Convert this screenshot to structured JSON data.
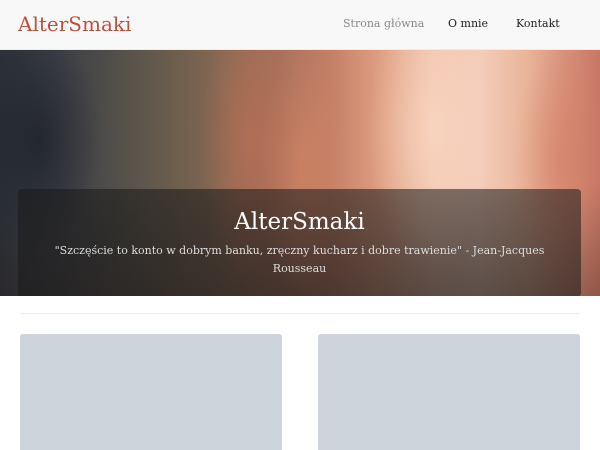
{
  "navbar": {
    "brand": "AlterSmaki",
    "links": [
      {
        "label": "Strona główna",
        "active": true
      },
      {
        "label": "O mnie",
        "active": false
      },
      {
        "label": "Kontakt",
        "active": false
      }
    ]
  },
  "hero": {
    "title": "AlterSmaki",
    "quote": "\"Szczęście to konto w dobrym banku, zręczny kucharz i dobre trawienie\" - Jean-Jacques Rousseau"
  },
  "colors": {
    "brand": "#c0503a",
    "card_placeholder": "#ced4dc",
    "navbar_background": "#f8f8f8"
  }
}
